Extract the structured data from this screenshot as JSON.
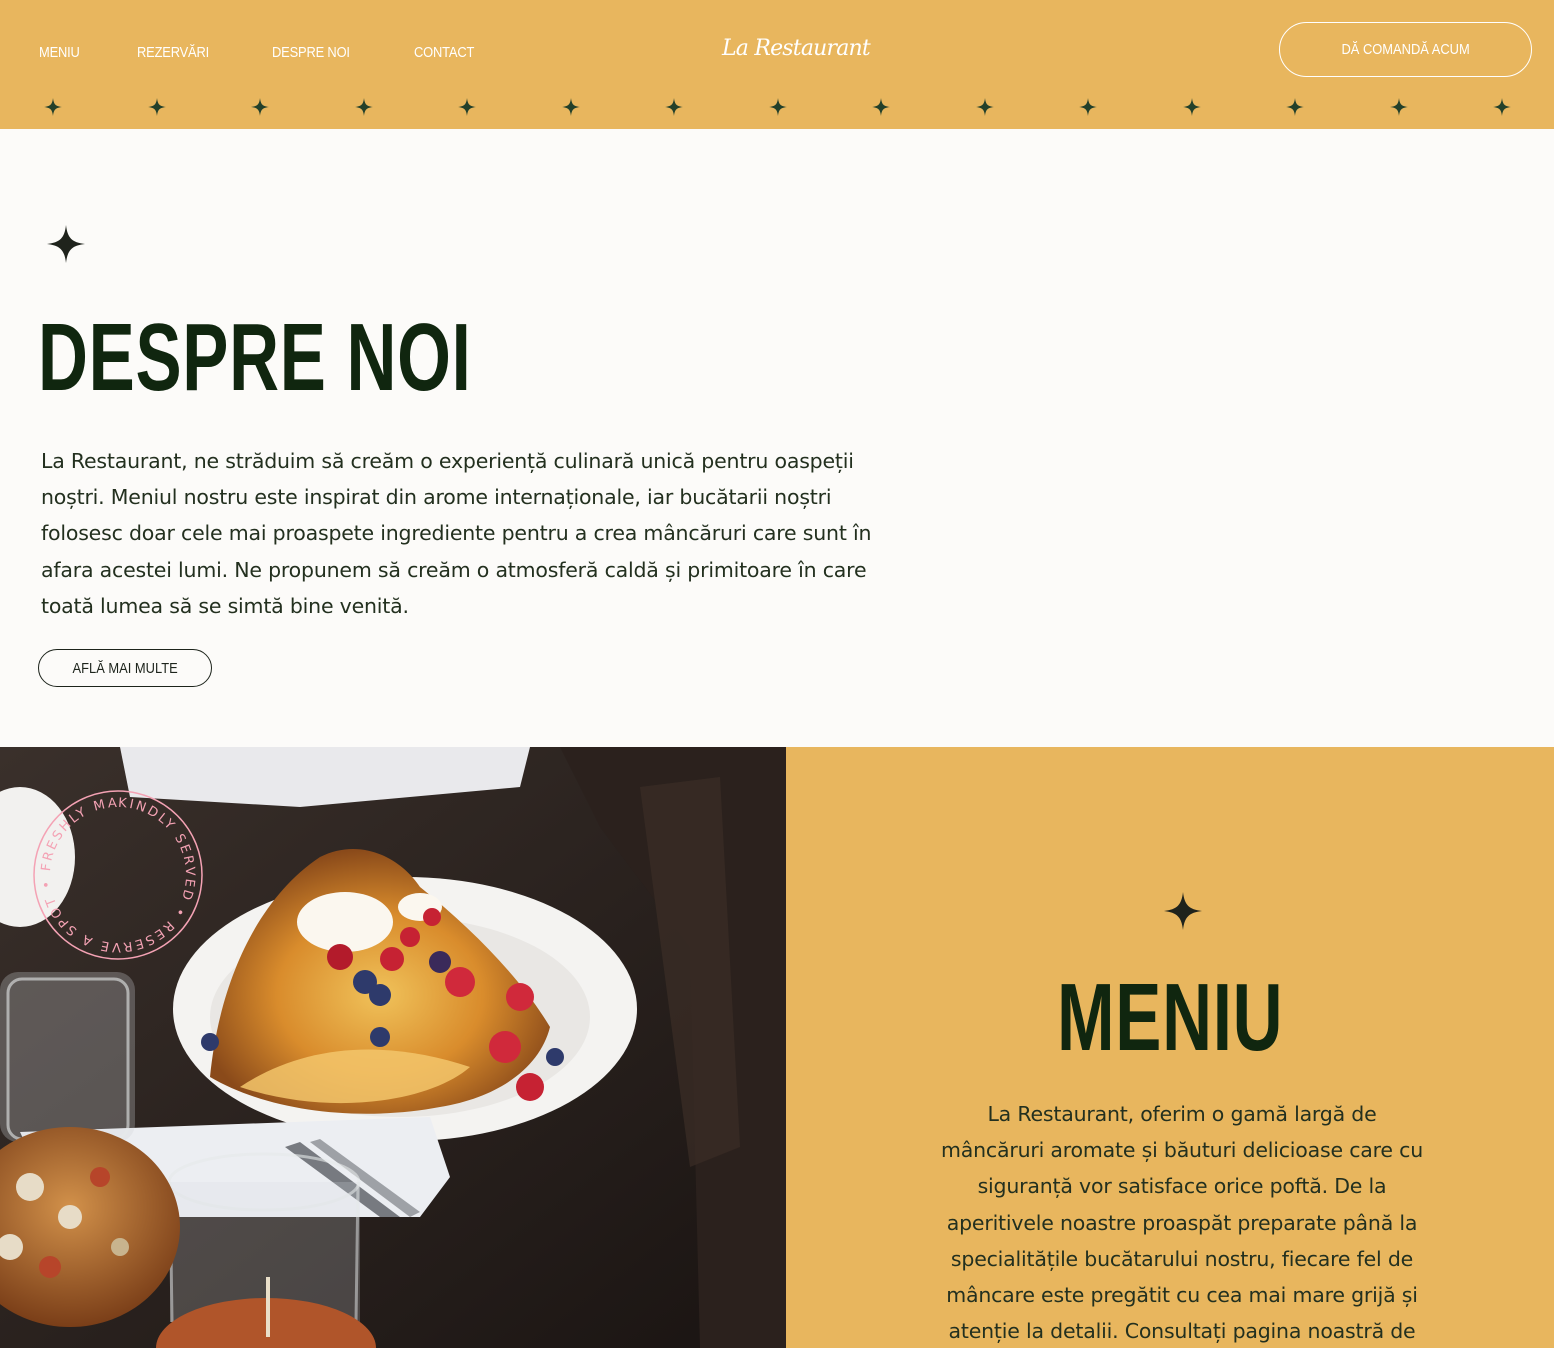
{
  "header": {
    "nav": [
      {
        "label": "MENIU"
      },
      {
        "label": "REZERVĂRI"
      },
      {
        "label": "DESPRE NOI"
      },
      {
        "label": "CONTACT"
      }
    ],
    "logo": "La Restaurant",
    "order_button": "DĂ COMANDĂ ACUM"
  },
  "about": {
    "title": "DESPRE NOI",
    "text": "La Restaurant, ne străduim să creăm o experiență culinară unică pentru oaspeții noștri. Meniul nostru este inspirat din arome internaționale, iar bucătarii noștri folosesc doar cele mai proaspete ingrediente pentru a crea mâncăruri care sunt în afara acestei lumi. Ne propunem să creăm o atmosferă caldă și primitoare în care toată lumea să se simtă bine venită.",
    "button": "AFLĂ MAI MULTE"
  },
  "photo": {
    "badge_text": "KINDLY SERVED • RESERVE A SPOT • FRESHLY MADE •"
  },
  "menu": {
    "title": "MENIU",
    "text": "La Restaurant, oferim o gamă largă de mâncăruri aromate și băuturi delicioase care cu siguranță vor satisface orice poftă. De la aperitivele noastre proaspăt preparate până la specialitățile bucătarului nostru, fiecare fel de mâncare este pregătit cu cea mai mare grijă și atenție la detalii. Consultați pagina noastră de"
  },
  "colors": {
    "accent": "#e8b65e",
    "title_green": "#10260f",
    "background": "#fcfbf9"
  }
}
